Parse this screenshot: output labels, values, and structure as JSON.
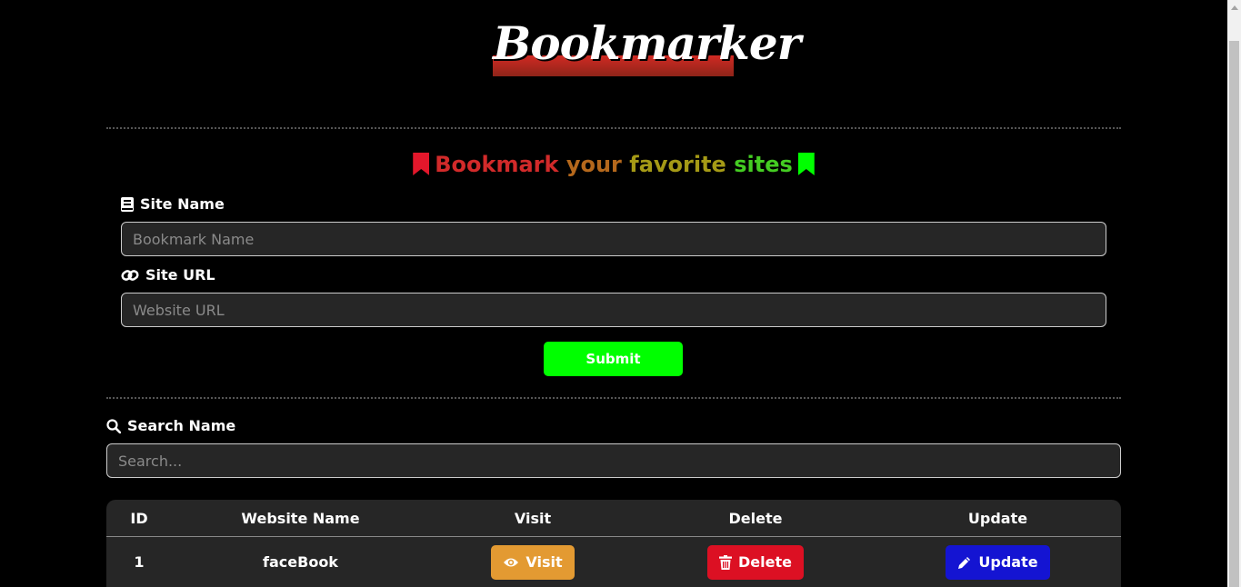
{
  "logo": {
    "text": "Bookmarker"
  },
  "heading": {
    "words": [
      "Bookmark",
      "your",
      "favorite",
      "sites"
    ]
  },
  "form": {
    "site_name_label": "Site Name",
    "site_name_placeholder": "Bookmark Name",
    "site_url_label": "Site URL",
    "site_url_placeholder": "Website URL",
    "submit_label": "Submit"
  },
  "search": {
    "label": "Search Name",
    "placeholder": "Search..."
  },
  "table": {
    "headers": [
      "ID",
      "Website Name",
      "Visit",
      "Delete",
      "Update"
    ],
    "rows": [
      {
        "id": "1",
        "name": "faceBook",
        "visit": "Visit",
        "delete": "Delete",
        "update": "Update"
      }
    ]
  },
  "colors": {
    "submit": "#00ff00",
    "visit": "#e39a32",
    "delete": "#dc1023",
    "update": "#1414d2"
  }
}
